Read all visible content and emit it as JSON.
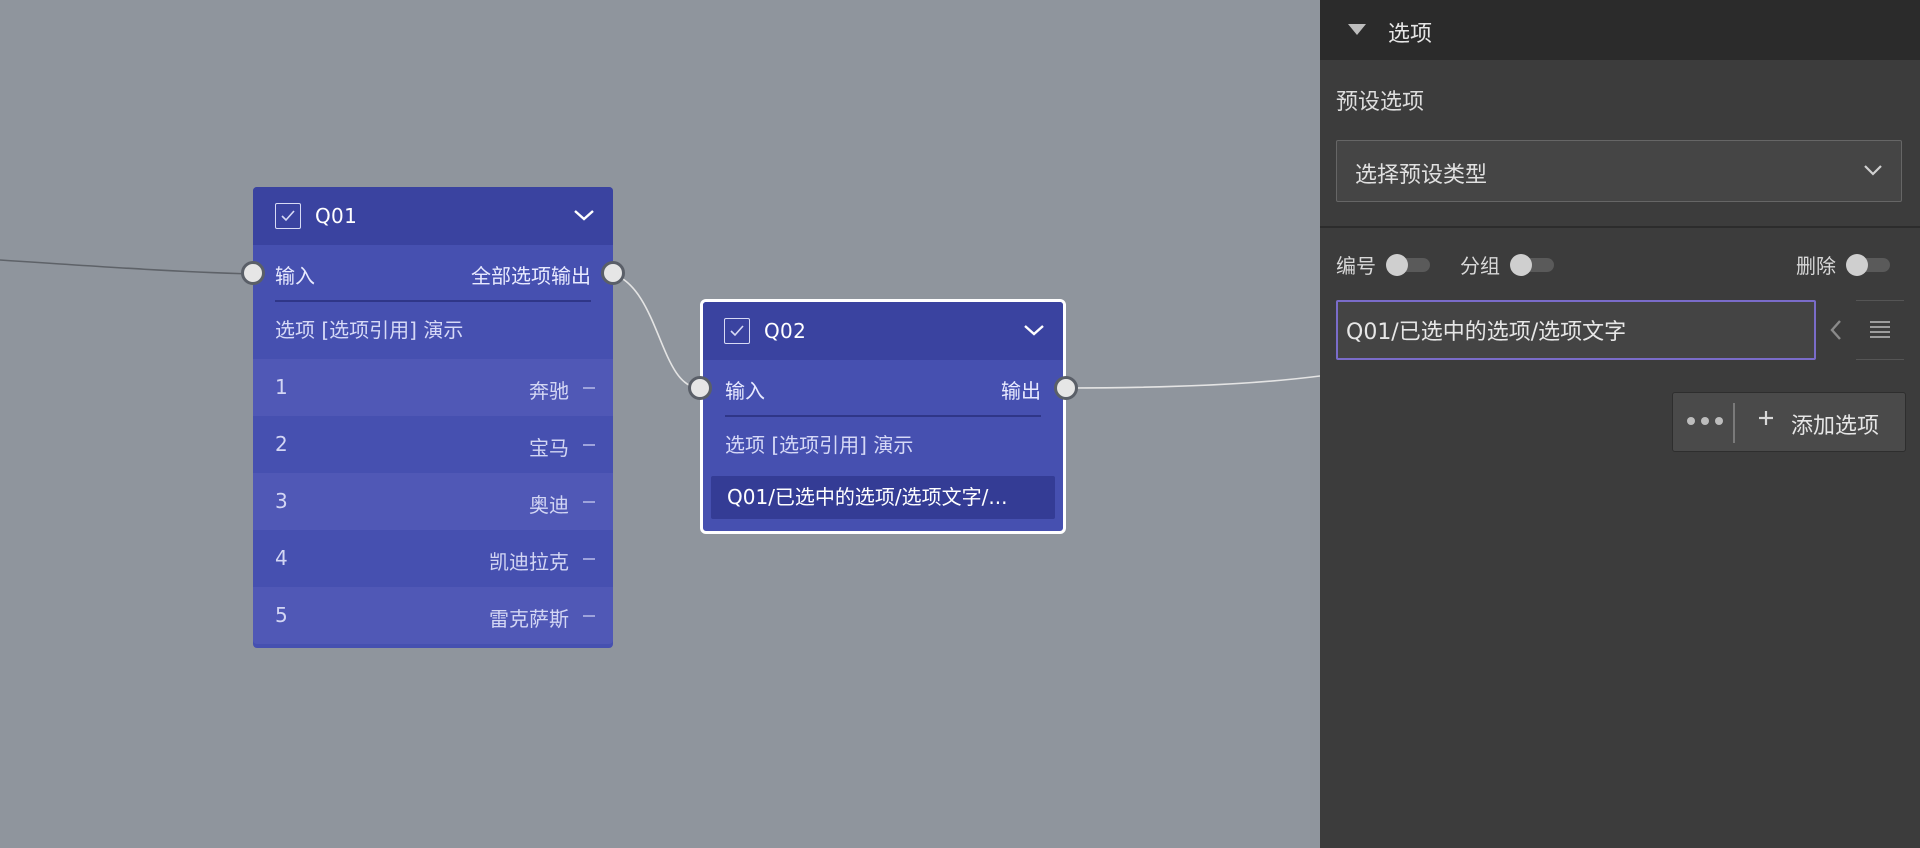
{
  "canvas": {
    "nodes": {
      "q01": {
        "title": "Q01",
        "input_label": "输入",
        "output_label": "全部选项输出",
        "description": "选项 [选项引用] 演示",
        "options": [
          {
            "num": "1",
            "label": "奔驰"
          },
          {
            "num": "2",
            "label": "宝马"
          },
          {
            "num": "3",
            "label": "奥迪"
          },
          {
            "num": "4",
            "label": "凯迪拉克"
          },
          {
            "num": "5",
            "label": "雷克萨斯"
          }
        ]
      },
      "q02": {
        "title": "Q02",
        "input_label": "输入",
        "output_label": "输出",
        "description": "选项 [选项引用] 演示",
        "reference_chip": "Q01/已选中的选项/选项文字/..."
      }
    }
  },
  "panel": {
    "title": "选项",
    "preset_label": "预设选项",
    "preset_select_value": "选择预设类型",
    "toggles": {
      "numbering": "编号",
      "grouping": "分组",
      "delete": "删除"
    },
    "option_input_value": "Q01/已选中的选项/选项文字",
    "add_option_label": "添加选项"
  },
  "colors": {
    "canvas_bg": "#8f959d",
    "node_bg": "#4650b0",
    "node_header": "#3a43a0",
    "panel_bg": "#3c3c3c",
    "accent_border": "#7a6cc9"
  },
  "icons": [
    "checkbox-icon",
    "chevron-down-icon",
    "triangle-down-icon",
    "chevron-left-icon",
    "list-icon",
    "more-icon",
    "plus-icon"
  ]
}
